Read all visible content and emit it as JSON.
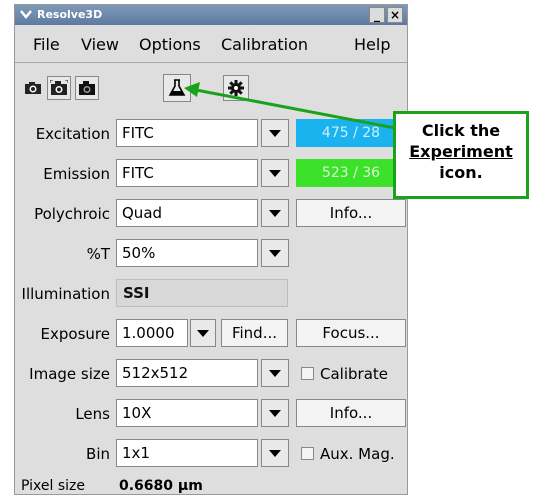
{
  "window": {
    "title": "Resolve3D"
  },
  "titlebar": {
    "min_symbol": "_",
    "close_symbol": "×",
    "menu_symbol": "⌄"
  },
  "menubar": {
    "items": [
      "File",
      "View",
      "Options",
      "Calibration",
      "Help"
    ]
  },
  "toolbar": {
    "tools": [
      {
        "icon": "camera-icon"
      },
      {
        "icon": "camera-focus-icon"
      },
      {
        "icon": "camera-dark-icon"
      },
      {
        "icon": "experiment-flask-icon"
      },
      {
        "icon": "gear-icon"
      }
    ]
  },
  "rows": {
    "excitation": {
      "label": "Excitation",
      "value": "FITC",
      "swatch": "475 / 28",
      "swatch_color": "#1ab3f0"
    },
    "emission": {
      "label": "Emission",
      "value": "FITC",
      "swatch": "523 / 36",
      "swatch_color": "#3ce22a"
    },
    "polychroic": {
      "label": "Polychroic",
      "value": "Quad",
      "button": "Info..."
    },
    "percent_t": {
      "label": "%T",
      "value": "50%"
    },
    "illumination": {
      "label": "Illumination",
      "value": "SSI"
    },
    "exposure": {
      "label": "Exposure",
      "value": "1.0000",
      "find": "Find...",
      "focus": "Focus..."
    },
    "image_size": {
      "label": "Image size",
      "value": "512x512",
      "check": "Calibrate"
    },
    "lens": {
      "label": "Lens",
      "value": "10X",
      "button": "Info..."
    },
    "bin": {
      "label": "Bin",
      "value": "1x1",
      "check": "Aux. Mag."
    },
    "pixel_size": {
      "label": "Pixel size",
      "value": "0.6680 µm"
    }
  },
  "callout": {
    "line1": "Click the",
    "line2": "Experiment",
    "line3": "icon.",
    "color": "#1aa31a"
  }
}
